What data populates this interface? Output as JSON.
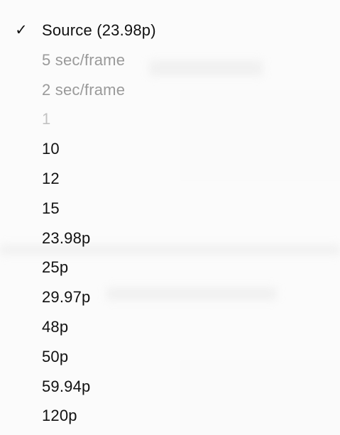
{
  "menu": {
    "items": [
      {
        "label": "Source (23.98p)",
        "checked": true,
        "state": "enabled"
      },
      {
        "label": "5 sec/frame",
        "checked": false,
        "state": "disabled"
      },
      {
        "label": "2 sec/frame",
        "checked": false,
        "state": "disabled"
      },
      {
        "label": "1",
        "checked": false,
        "state": "disabled"
      },
      {
        "label": "10",
        "checked": false,
        "state": "enabled"
      },
      {
        "label": "12",
        "checked": false,
        "state": "enabled"
      },
      {
        "label": "15",
        "checked": false,
        "state": "enabled"
      },
      {
        "label": "23.98p",
        "checked": false,
        "state": "enabled"
      },
      {
        "label": "25p",
        "checked": false,
        "state": "enabled"
      },
      {
        "label": "29.97p",
        "checked": false,
        "state": "enabled"
      },
      {
        "label": "48p",
        "checked": false,
        "state": "enabled"
      },
      {
        "label": "50p",
        "checked": false,
        "state": "enabled"
      },
      {
        "label": "59.94p",
        "checked": false,
        "state": "enabled"
      },
      {
        "label": "120p",
        "checked": false,
        "state": "enabled"
      }
    ],
    "check_glyph": "✓",
    "check_icon": "checkmark-icon"
  }
}
